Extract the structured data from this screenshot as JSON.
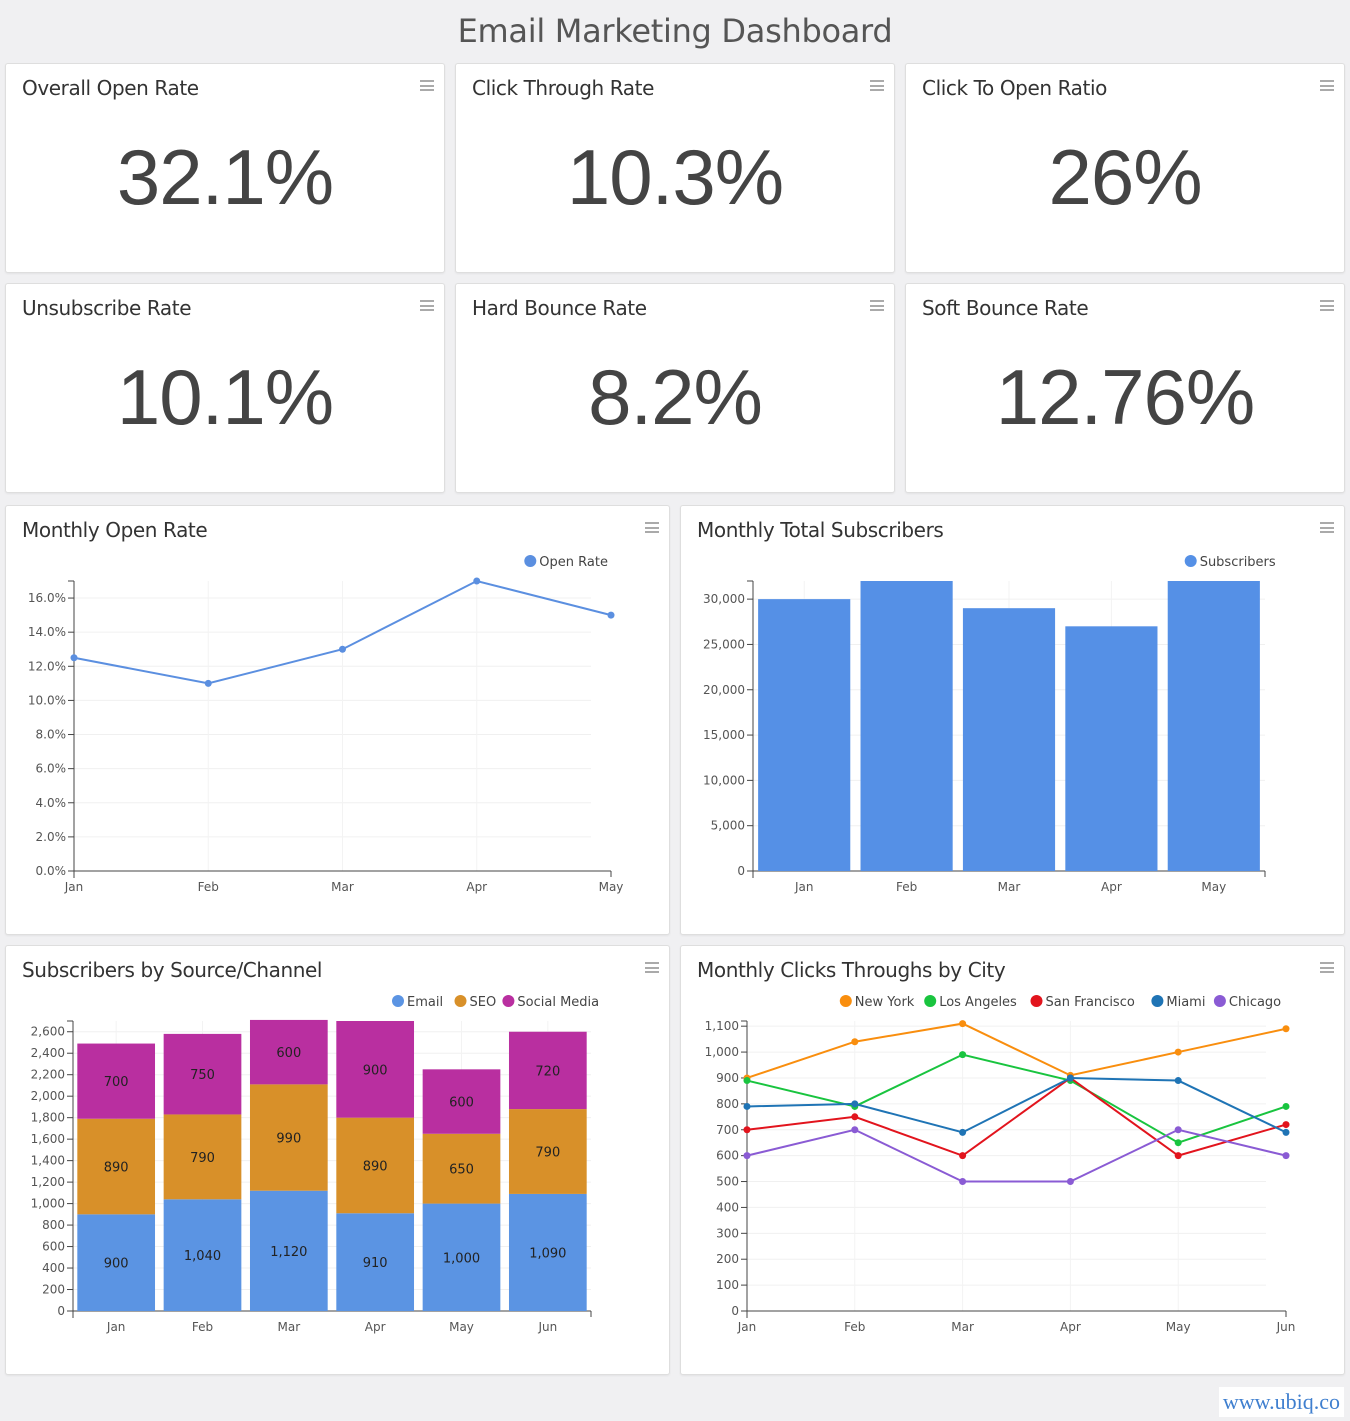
{
  "header": {
    "title": "Email Marketing Dashboard"
  },
  "kpis": [
    {
      "label": "Overall Open Rate",
      "value": "32.1%"
    },
    {
      "label": "Click Through Rate",
      "value": "10.3%"
    },
    {
      "label": "Click To Open Ratio",
      "value": "26%"
    },
    {
      "label": "Unsubscribe Rate",
      "value": "10.1%"
    },
    {
      "label": "Hard Bounce Rate",
      "value": "8.2%"
    },
    {
      "label": "Soft Bounce Rate",
      "value": "12.76%"
    }
  ],
  "watermark": "www.ubiq.co",
  "chart_data": [
    {
      "id": "open-rate",
      "type": "line",
      "title": "Monthly Open Rate",
      "categories": [
        "Jan",
        "Feb",
        "Mar",
        "Apr",
        "May"
      ],
      "series": [
        {
          "name": "Open Rate",
          "color": "#5b8fe0",
          "values": [
            12.5,
            11.0,
            13.0,
            17.0,
            15.0
          ]
        }
      ],
      "ylim": [
        0,
        17
      ],
      "yticks": [
        0,
        2,
        4,
        6,
        8,
        10,
        12,
        14,
        16
      ],
      "ytick_labels": [
        "0.0%",
        "2.0%",
        "4.0%",
        "6.0%",
        "8.0%",
        "10.0%",
        "12.0%",
        "14.0%",
        "16.0%"
      ],
      "legend": "top-right",
      "grid": true
    },
    {
      "id": "subscribers",
      "type": "bar",
      "title": "Monthly Total Subscribers",
      "categories": [
        "Jan",
        "Feb",
        "Mar",
        "Apr",
        "May"
      ],
      "series": [
        {
          "name": "Subscribers",
          "color": "#5590e6",
          "values": [
            30000,
            32000,
            29000,
            27000,
            32000
          ]
        }
      ],
      "ylim": [
        0,
        32000
      ],
      "yticks": [
        0,
        5000,
        10000,
        15000,
        20000,
        25000,
        30000
      ],
      "ytick_labels": [
        "0",
        "5,000",
        "10,000",
        "15,000",
        "20,000",
        "25,000",
        "30,000"
      ],
      "legend": "top-right",
      "grid": true
    },
    {
      "id": "source-channel",
      "type": "bar",
      "stacked": true,
      "title": "Subscribers by Source/Channel",
      "categories": [
        "Jan",
        "Feb",
        "Mar",
        "Apr",
        "May",
        "Jun"
      ],
      "series": [
        {
          "name": "Email",
          "color": "#5b94e3",
          "values": [
            900,
            1040,
            1120,
            910,
            1000,
            1090
          ],
          "labels": [
            "900",
            "1,040",
            "1,120",
            "910",
            "1,000",
            "1,090"
          ]
        },
        {
          "name": "SEO",
          "color": "#d89029",
          "values": [
            890,
            790,
            990,
            890,
            650,
            790
          ],
          "labels": [
            "890",
            "790",
            "990",
            "890",
            "650",
            "790"
          ]
        },
        {
          "name": "Social Media",
          "color": "#b92fa0",
          "values": [
            700,
            750,
            600,
            900,
            600,
            720
          ],
          "labels": [
            "700",
            "750",
            "600",
            "900",
            "600",
            "720"
          ]
        }
      ],
      "ylim": [
        0,
        2700
      ],
      "yticks": [
        0,
        200,
        400,
        600,
        800,
        1000,
        1200,
        1400,
        1600,
        1800,
        2000,
        2200,
        2400,
        2600
      ],
      "ytick_labels": [
        "0",
        "200",
        "400",
        "600",
        "800",
        "1,000",
        "1,200",
        "1,400",
        "1,600",
        "1,800",
        "2,000",
        "2,200",
        "2,400",
        "2,600"
      ],
      "legend": "top-right",
      "grid": true
    },
    {
      "id": "city-clicks",
      "type": "line",
      "title": "Monthly Clicks Throughs by City",
      "categories": [
        "Jan",
        "Feb",
        "Mar",
        "Apr",
        "May",
        "Jun"
      ],
      "series": [
        {
          "name": "New York",
          "color": "#f98e0e",
          "values": [
            900,
            1040,
            1110,
            910,
            1000,
            1090
          ]
        },
        {
          "name": "Los Angeles",
          "color": "#19c43f",
          "values": [
            890,
            790,
            990,
            890,
            650,
            790
          ]
        },
        {
          "name": "San Francisco",
          "color": "#e2141d",
          "values": [
            700,
            750,
            600,
            900,
            600,
            720
          ]
        },
        {
          "name": "Miami",
          "color": "#1f74b5",
          "values": [
            790,
            800,
            690,
            900,
            890,
            690
          ]
        },
        {
          "name": "Chicago",
          "color": "#8a5bd4",
          "values": [
            600,
            700,
            500,
            500,
            700,
            600
          ]
        }
      ],
      "ylim": [
        0,
        1120
      ],
      "yticks": [
        0,
        100,
        200,
        300,
        400,
        500,
        600,
        700,
        800,
        900,
        1000,
        1100
      ],
      "ytick_labels": [
        "0",
        "100",
        "200",
        "300",
        "400",
        "500",
        "600",
        "700",
        "800",
        "900",
        "1,000",
        "1,100"
      ],
      "legend": "top-right",
      "grid": true
    }
  ]
}
